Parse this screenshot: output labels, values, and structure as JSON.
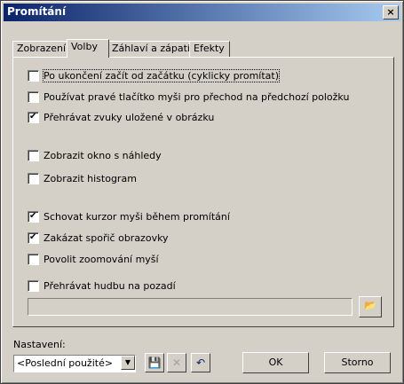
{
  "window": {
    "title": "Promítání",
    "close_label": "×"
  },
  "tabs": [
    "Zobrazení",
    "Volby",
    "Záhlaví a zápatí",
    "Efekty"
  ],
  "options": [
    {
      "label": "Po ukončení začít od začátku (cyklicky promítat)",
      "checked": false
    },
    {
      "label": "Používat pravé tlačítko myši pro přechod na předchozí položku",
      "checked": false
    },
    {
      "label": "Přehrávat zvuky uložené v obrázku",
      "checked": true
    },
    {
      "label": "Zobrazit okno s náhledy",
      "checked": false
    },
    {
      "label": "Zobrazit histogram",
      "checked": false
    },
    {
      "label": "Schovat kurzor myši během promítání",
      "checked": true
    },
    {
      "label": "Zakázat spořič obrazovky",
      "checked": true
    },
    {
      "label": "Povolit zoomování myší",
      "checked": false
    },
    {
      "label": "Přehrávat hudbu na pozadí",
      "checked": false
    }
  ],
  "music_path": {
    "value": ""
  },
  "settings": {
    "label": "Nastavení:",
    "selected": "<Poslední použité>"
  },
  "buttons": {
    "ok": "OK",
    "cancel": "Storno"
  },
  "icons": {
    "save": "save-icon",
    "delete": "delete-icon",
    "undo": "undo-icon",
    "browse": "folder-open-icon"
  }
}
